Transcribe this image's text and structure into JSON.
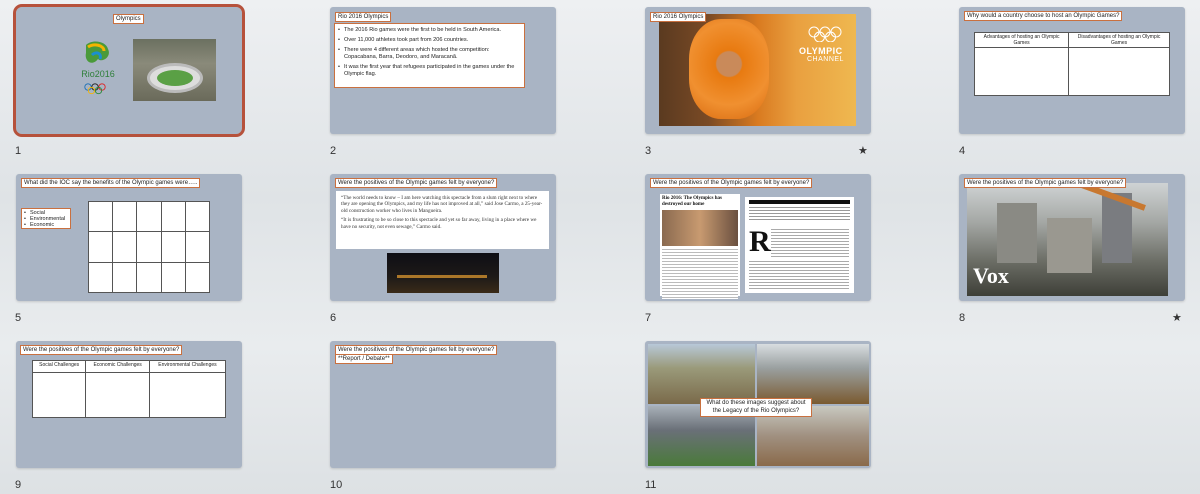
{
  "slides": [
    {
      "num": "1",
      "title": "Olympics",
      "rings_text": "Rio2016"
    },
    {
      "num": "2",
      "title": "Rio 2016 Olympics",
      "bullets": [
        "The 2016 Rio games were the first to be held in South America.",
        "Over 11,000 athletes took part from 206 countries.",
        "There were 4 different areas which hosted the competition: Copacabana, Barra, Deodoro, and Maracanã.",
        "It was the first year that refugees participated in the games under the Olympic flag."
      ]
    },
    {
      "num": "3",
      "title": "Rio 2016 Olympics",
      "brand": "OLYMPIC",
      "brand2": "CHANNEL"
    },
    {
      "num": "4",
      "title": "Why would a country choose to host an Olympic Games?",
      "col1": "Advantages of hosting an Olympic Games",
      "col2": "Disadvantages of hosting an Olympic Games"
    },
    {
      "num": "5",
      "title": "What did the IOC say the benefits of the Olympic games were…..",
      "bullets": [
        "Social",
        "Environmental",
        "Economic"
      ]
    },
    {
      "num": "6",
      "title": "Were the positives of the Olympic games felt by everyone?",
      "quote1": "“The world needs to know – I am here watching this spectacle from a slum right next to where they are opening the Olympics, and my life has not improved at all,” said Jose Carmo, a 25-year-old construction worker who lives in Mangueira.",
      "quote2": "“It is frustrating to be so close to this spectacle and yet so far away, living in a place where we have no security, not even sewage,” Carmo said."
    },
    {
      "num": "7",
      "title": "Were the positives of the Olympic games felt by everyone?",
      "headline": "Rio 2016: The Olympics has destroyed our home",
      "dropcap": "R"
    },
    {
      "num": "8",
      "title": "Were the positives of the Olympic games felt by everyone?",
      "logo": "Vox"
    },
    {
      "num": "9",
      "title": "Were the positives of the Olympic games felt by everyone?",
      "cols": [
        "Social Challenges",
        "Economic Challenges",
        "Environmental Challenges"
      ]
    },
    {
      "num": "10",
      "title": "Were the positives of the Olympic games felt by everyone?",
      "sub": "**Report / Debate**"
    },
    {
      "num": "11",
      "caption": "What do these images suggest about the Legacy of the Rio Olympics?"
    }
  ],
  "stars": [
    "★",
    "★"
  ]
}
